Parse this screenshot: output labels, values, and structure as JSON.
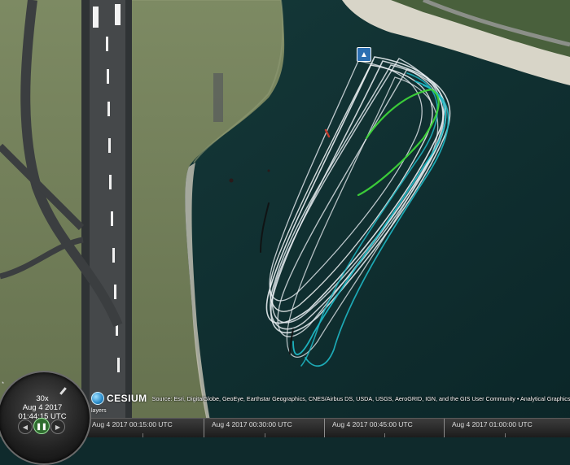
{
  "map": {
    "colors": {
      "water": "#0f2f30",
      "land": "#6f7d5a",
      "runway": "#3f4244",
      "beach": "#d8d5c8",
      "track_white": "#e9eef2",
      "track_cyan": "#1fb7c4",
      "track_green": "#3ed43a",
      "track_black": "#111111"
    }
  },
  "attribution": {
    "logo_text": "CESIUM",
    "credits": "Source: Esri, DigitalGlobe, GeoEye, Earthstar Geographics, CNES/Airbus DS, USDA, USGS, AeroGRID, IGN, and the GIS User Community • Analytical Graphics"
  },
  "layers": {
    "label": "layers"
  },
  "animation": {
    "speed": "30x",
    "date": "Aug 4 2017",
    "time": "01:44:15 UTC",
    "play_icon": "pause-icon"
  },
  "timeline": {
    "labels": [
      "Aug 4 2017 00:15:00 UTC",
      "Aug 4 2017 00:30:00 UTC",
      "Aug 4 2017 00:45:00 UTC",
      "Aug 4 2017 01:00:00 UTC"
    ]
  }
}
